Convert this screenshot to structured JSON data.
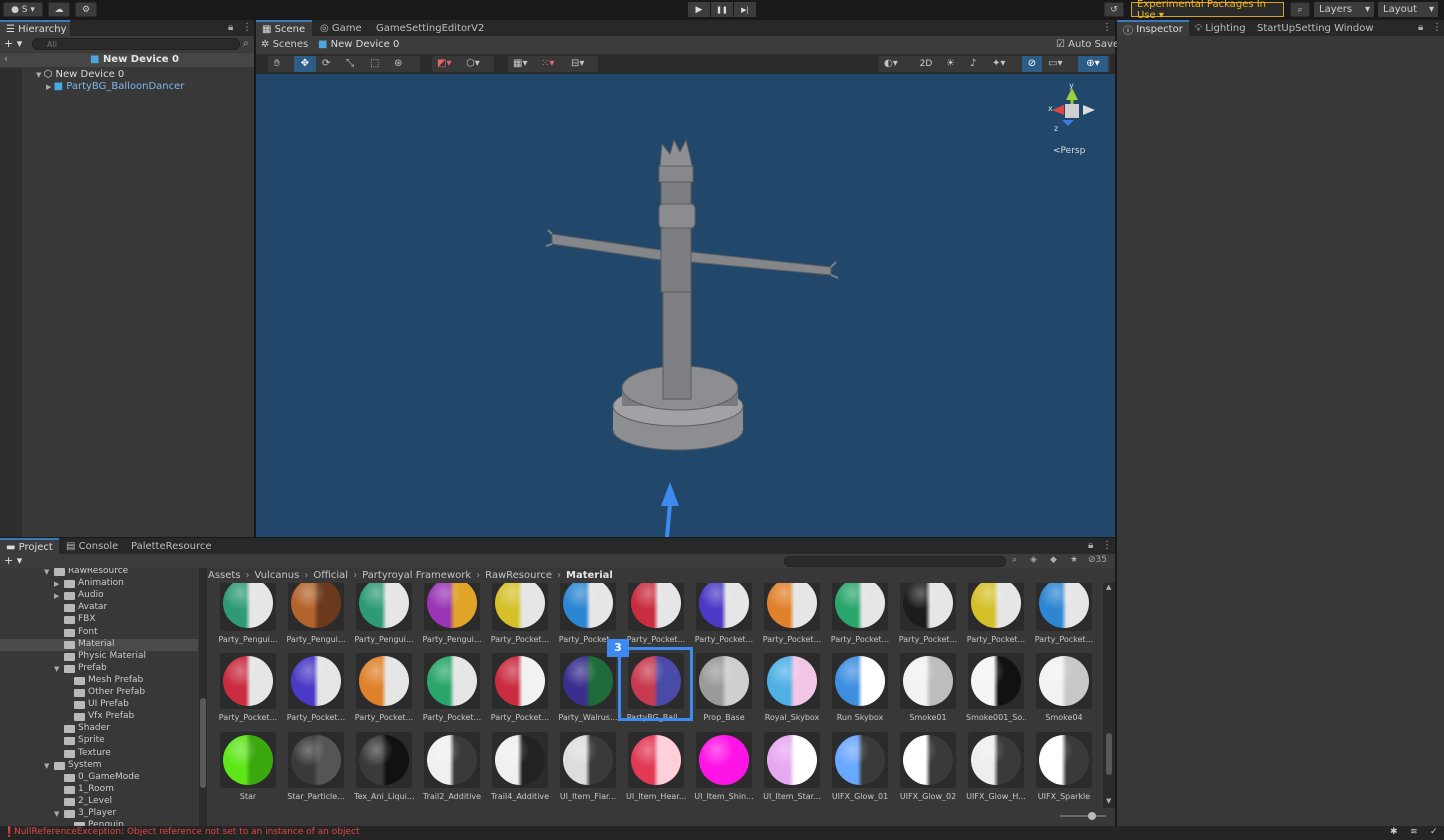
{
  "toolbar": {
    "account": "S",
    "play_icon": "▶",
    "pause_icon": "❚❚",
    "step_icon": "▶|",
    "experimental": "Experimental Packages In Use ▾",
    "layers": "Layers",
    "layout": "Layout"
  },
  "hierarchy": {
    "tab": "Hierarchy",
    "search_placeholder": "All",
    "scene_title": "New Device 0",
    "root": "New Device 0",
    "child": "PartyBG_BalloonDancer"
  },
  "scene": {
    "tabs": [
      "Scene",
      "Game",
      "GameSettingEditorV2"
    ],
    "breadcrumb_root": "Scenes",
    "breadcrumb_current": "New Device 0",
    "autosave": "Auto Save",
    "mode_2d": "2D",
    "persp": "Persp",
    "gizmo_y": "y",
    "gizmo_x": "x",
    "gizmo_z": "z"
  },
  "inspector": {
    "tabs": [
      "Inspector",
      "Lighting",
      "StartUpSetting Window"
    ]
  },
  "project": {
    "tabs": [
      "Project",
      "Console",
      "PaletteResource"
    ],
    "count": "35",
    "tree": [
      {
        "label": "RawResource",
        "depth": 0,
        "open": true
      },
      {
        "label": "Animation",
        "depth": 1,
        "open": false
      },
      {
        "label": "Audio",
        "depth": 1,
        "open": false
      },
      {
        "label": "Avatar",
        "depth": 1
      },
      {
        "label": "FBX",
        "depth": 1
      },
      {
        "label": "Font",
        "depth": 1
      },
      {
        "label": "Material",
        "depth": 1,
        "selected": true
      },
      {
        "label": "Physic Material",
        "depth": 1
      },
      {
        "label": "Prefab",
        "depth": 1,
        "open": true
      },
      {
        "label": "Mesh Prefab",
        "depth": 2
      },
      {
        "label": "Other Prefab",
        "depth": 2
      },
      {
        "label": "UI Prefab",
        "depth": 2
      },
      {
        "label": "Vfx Prefab",
        "depth": 2
      },
      {
        "label": "Shader",
        "depth": 1
      },
      {
        "label": "Sprite",
        "depth": 1
      },
      {
        "label": "Texture",
        "depth": 1
      },
      {
        "label": "System",
        "depth": 0,
        "open": true
      },
      {
        "label": "0_GameMode",
        "depth": 1
      },
      {
        "label": "1_Room",
        "depth": 1
      },
      {
        "label": "2_Level",
        "depth": 1
      },
      {
        "label": "3_Player",
        "depth": 1,
        "open": true
      },
      {
        "label": "Penguin",
        "depth": 2
      }
    ],
    "breadcrumb": [
      "Assets",
      "Vulcanus",
      "Official",
      "Partyroyal Framework",
      "RawResource",
      "Material"
    ],
    "rows": [
      [
        {
          "label": "Party_Pengui...",
          "a": "#2f9b74",
          "b": "#e6e6e6"
        },
        {
          "label": "Party_Pengui...",
          "a": "#b3632c",
          "b": "#6b3a1d"
        },
        {
          "label": "Party_Pengui...",
          "a": "#2f9b74",
          "b": "#e6e6e6"
        },
        {
          "label": "Party_Pengui...",
          "a": "#9a35b5",
          "b": "#e0a428"
        },
        {
          "label": "Party_Pocket...",
          "a": "#d6c02a",
          "b": "#e6e6e6"
        },
        {
          "label": "Party_Pocket...",
          "a": "#2c86d2",
          "b": "#e6e6e6"
        },
        {
          "label": "Party_Pocket...",
          "a": "#c92d3f",
          "b": "#e6e6e6"
        },
        {
          "label": "Party_Pocket...",
          "a": "#4a3ac6",
          "b": "#e6e6e6"
        },
        {
          "label": "Party_Pocket...",
          "a": "#e0812b",
          "b": "#e6e6e6"
        },
        {
          "label": "Party_Pocket...",
          "a": "#2aa56b",
          "b": "#e6e6e6"
        },
        {
          "label": "Party_Pocket...",
          "a": "#1c1c1c",
          "b": "#e6e6e6"
        },
        {
          "label": "Party_Pocket...",
          "a": "#d6c02a",
          "b": "#e6e6e6"
        },
        {
          "label": "Party_Pocket...",
          "a": "#2c86d2",
          "b": "#e6e6e6"
        }
      ],
      [
        {
          "label": "Party_Pocket...",
          "a": "#c92d3f",
          "b": "#e6e6e6"
        },
        {
          "label": "Party_Pocket...",
          "a": "#4a3ac6",
          "b": "#e6e6e6"
        },
        {
          "label": "Party_Pocket...",
          "a": "#e0812b",
          "b": "#e6e6e6"
        },
        {
          "label": "Party_Pocket...",
          "a": "#2aa56b",
          "b": "#e6e6e6"
        },
        {
          "label": "Party_Pocket...",
          "a": "#c92d3f",
          "b": "#f2f2f2"
        },
        {
          "label": "Party_Walrus...",
          "a": "#3a2f8f",
          "b": "#1f6b3a"
        },
        {
          "label": "PartyBG_Ball...",
          "a": "#c83a50",
          "b": "#4a4aa8"
        },
        {
          "label": "Prop_Base",
          "a": "#9a9a9a",
          "b": "#cfcfcf"
        },
        {
          "label": "Royal_Skybox",
          "a": "#4fb0e6",
          "b": "#f4c6e6"
        },
        {
          "label": "Run Skybox",
          "a": "#3e8fe0",
          "b": "#ffffff"
        },
        {
          "label": "Smoke01",
          "a": "#f2f2f2",
          "b": "#bdbdbd"
        },
        {
          "label": "Smoke001_So...",
          "a": "#f5f5f5",
          "b": "#111111"
        },
        {
          "label": "Smoke04",
          "a": "#f2f2f2",
          "b": "#c8c8c8"
        }
      ],
      [
        {
          "label": "Star",
          "a": "#5ee61a",
          "b": "#3aa80e"
        },
        {
          "label": "Star_Particle...",
          "a": "#3a3a3a",
          "b": "#555555"
        },
        {
          "label": "Tex_Ani_Liqui...",
          "a": "#3a3a3a",
          "b": "#111111"
        },
        {
          "label": "Trail2_Additive",
          "a": "#f0f0f0",
          "b": "#3a3a3a"
        },
        {
          "label": "Trail4_Additive",
          "a": "#f0f0f0",
          "b": "#222222"
        },
        {
          "label": "UI_Item_Flar...",
          "a": "#dddddd",
          "b": "#3a3a3a"
        },
        {
          "label": "UI_Item_Hear...",
          "a": "#e23a54",
          "b": "#ffd0da"
        },
        {
          "label": "UI_Item_Shin...",
          "a": "#ff14e6",
          "b": "#ff14e6"
        },
        {
          "label": "UI_Item_Star...",
          "a": "#e6a8f0",
          "b": "#ffffff"
        },
        {
          "label": "UIFX_Glow_01",
          "a": "#6aa8ff",
          "b": "#3a3a3a"
        },
        {
          "label": "UIFX_Glow_02",
          "a": "#ffffff",
          "b": "#3a3a3a"
        },
        {
          "label": "UIFX_Glow_H...",
          "a": "#eeeeee",
          "b": "#3a3a3a"
        },
        {
          "label": "UIFX_Sparkle",
          "a": "#ffffff",
          "b": "#3a3a3a"
        }
      ]
    ]
  },
  "annotation": {
    "number": "3",
    "color": "#3d8bf0"
  },
  "status": {
    "error": "NullReferenceException: Object reference not set to an instance of an object"
  },
  "colors": {
    "scene_bg": "#21476b",
    "accent": "#3a79bb",
    "selection": "#2c5d87",
    "error": "#e04545"
  }
}
